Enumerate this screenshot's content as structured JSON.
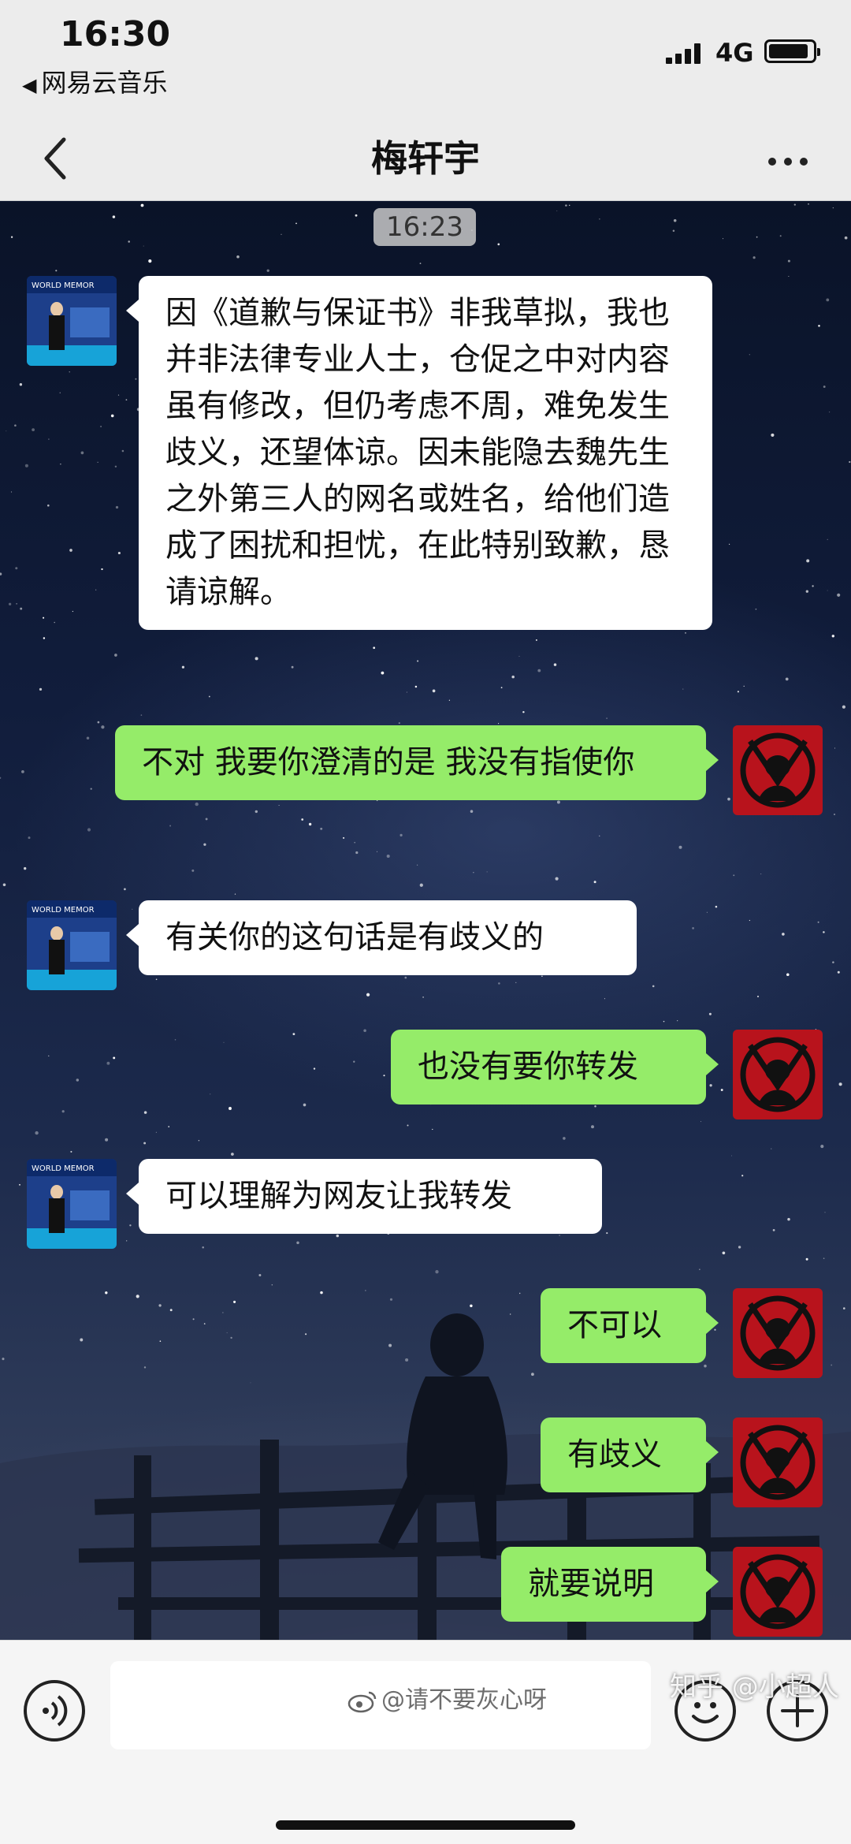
{
  "status_bar": {
    "time": "16:30",
    "back_app": "网易云音乐",
    "network": "4G",
    "battery_level": 0.9
  },
  "header": {
    "title": "梅轩宇",
    "back_icon": "chevron-left-icon",
    "more_icon": "more-icon"
  },
  "chat": {
    "timestamp": "16:23",
    "messages": [
      {
        "sender": "contact",
        "text": "因《道歉与保证书》非我草拟，我也并非法律专业人士，仓促之中对内容虽有修改，但仍考虑不周，难免发生歧义，还望体谅。因未能隐去魏先生之外第三人的网名或姓名，给他们造成了困扰和担忧，在此特别致歉，恳请谅解。"
      },
      {
        "sender": "self",
        "text": "不对 我要你澄清的是 我没有指使你"
      },
      {
        "sender": "contact",
        "text": "有关你的这句话是有歧义的"
      },
      {
        "sender": "self",
        "text": "也没有要你转发"
      },
      {
        "sender": "contact",
        "text": "可以理解为网友让我转发"
      },
      {
        "sender": "self",
        "text": "不可以"
      },
      {
        "sender": "self",
        "text": "有歧义"
      },
      {
        "sender": "self",
        "text": "就要说明"
      }
    ]
  },
  "input_bar": {
    "voice_icon": "voice-icon",
    "emoji_icon": "emoji-icon",
    "plus_icon": "plus-icon",
    "text_value": ""
  },
  "watermarks": {
    "weibo": "@请不要灰心呀",
    "zhihu": "知乎 @小超人"
  },
  "colors": {
    "self_bubble": "#95ec69",
    "contact_bubble": "#ffffff",
    "header_bg": "#ececec"
  }
}
